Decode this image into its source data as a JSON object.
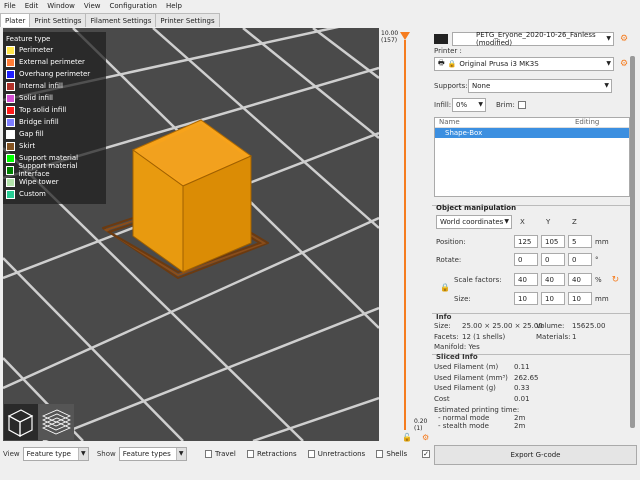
{
  "menu": [
    "File",
    "Edit",
    "Window",
    "View",
    "Configuration",
    "Help"
  ],
  "tabs": [
    {
      "label": "Plater",
      "active": true
    },
    {
      "label": "Print Settings",
      "active": false
    },
    {
      "label": "Filament Settings",
      "active": false
    },
    {
      "label": "Printer Settings",
      "active": false
    }
  ],
  "legend": {
    "title": "Feature type",
    "items": [
      {
        "label": "Perimeter",
        "color": "#ffe64d"
      },
      {
        "label": "External perimeter",
        "color": "#ff7d38"
      },
      {
        "label": "Overhang perimeter",
        "color": "#1f1fff"
      },
      {
        "label": "Internal infill",
        "color": "#b03029"
      },
      {
        "label": "Solid infill",
        "color": "#d64fd6"
      },
      {
        "label": "Top solid infill",
        "color": "#ff1a1a"
      },
      {
        "label": "Bridge infill",
        "color": "#7d7dff"
      },
      {
        "label": "Gap fill",
        "color": "#ffffff"
      },
      {
        "label": "Skirt",
        "color": "#845321"
      },
      {
        "label": "Support material",
        "color": "#00ff00"
      },
      {
        "label": "Support material interface",
        "color": "#008000"
      },
      {
        "label": "Wipe tower",
        "color": "#b3e3ab"
      },
      {
        "label": "Custom",
        "color": "#28cc94"
      }
    ]
  },
  "layer_slider": {
    "top_value": "10.00",
    "top_layer": "(157)",
    "bottom_value": "0.20",
    "bottom_layer": "(1)"
  },
  "bottom_bar": {
    "view_label": "View",
    "view_value": "Feature type",
    "show_label": "Show",
    "show_value": "Feature types",
    "options": [
      {
        "label": "Travel",
        "checked": false
      },
      {
        "label": "Retractions",
        "checked": false
      },
      {
        "label": "Unretractions",
        "checked": false
      },
      {
        "label": "Shells",
        "checked": false
      }
    ]
  },
  "sidebar": {
    "filament": "PETG_Eryone_2020-10-26_Fanless (modified)",
    "printer_label": "Printer :",
    "printer": "Original Prusa i3 MK3S",
    "supports_label": "Supports:",
    "supports_value": "None",
    "infill_label": "Infill:",
    "infill_value": "0%",
    "brim_label": "Brim:",
    "object_list": {
      "col_name": "Name",
      "col_editing": "Editing",
      "rows": [
        "Shape-Box"
      ]
    },
    "object_manipulation": {
      "title": "Object manipulation",
      "coord_mode": "World coordinates",
      "axes": [
        "X",
        "Y",
        "Z"
      ],
      "position_label": "Position:",
      "position": [
        "125",
        "105",
        "5"
      ],
      "position_unit": "mm",
      "rotate_label": "Rotate:",
      "rotate": [
        "0",
        "0",
        "0"
      ],
      "rotate_unit": "°",
      "scale_label": "Scale factors:",
      "scale": [
        "40",
        "40",
        "40"
      ],
      "scale_unit": "%",
      "size_label": "Size:",
      "size": [
        "10",
        "10",
        "10"
      ],
      "size_unit": "mm"
    },
    "info": {
      "title": "Info",
      "size_label": "Size:",
      "size_value": "25.00 × 25.00 × 25.00",
      "volume_label": "Volume:",
      "volume_value": "15625.00",
      "facets_label": "Facets:",
      "facets_value": "12 (1 shells)",
      "materials_label": "Materials:",
      "materials_value": "1",
      "manifold": "Manifold: Yes"
    },
    "sliced_info": {
      "title": "Sliced Info",
      "rows": [
        {
          "label": "Used Filament (m)",
          "value": "0.11"
        },
        {
          "label": "Used Filament (mm³)",
          "value": "262.65"
        },
        {
          "label": "Used Filament (g)",
          "value": "0.33"
        },
        {
          "label": "Cost",
          "value": "0.01"
        }
      ],
      "estimated_label": "Estimated printing time:",
      "normal_label": "- normal mode",
      "normal_value": "2m",
      "stealth_label": "- stealth mode",
      "stealth_value": "2m"
    },
    "export_label": "Export G-code"
  }
}
